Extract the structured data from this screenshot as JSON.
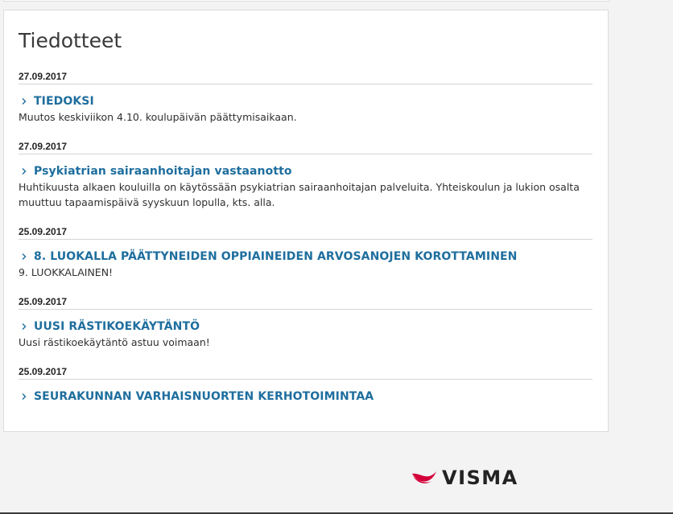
{
  "section": {
    "title": "Tiedotteet"
  },
  "news": [
    {
      "date": "27.09.2017",
      "title": "TIEDOKSI",
      "body": "Muutos keskiviikon 4.10. koulupäivän päättymisaikaan."
    },
    {
      "date": "27.09.2017",
      "title": "Psykiatrian sairaanhoitajan vastaanotto",
      "body": "Huhtikuusta alkaen kouluilla on käytössään psykiatrian sairaanhoitajan palveluita. Yhteiskoulun ja lukion osalta muuttuu tapaamispäivä syyskuun lopulla, kts. alla."
    },
    {
      "date": "25.09.2017",
      "title": "8. LUOKALLA PÄÄTTYNEIDEN OPPIAINEIDEN ARVOSANOJEN KOROTTAMINEN",
      "body": "9. LUOKKALAINEN!"
    },
    {
      "date": "25.09.2017",
      "title": "UUSI RÄSTIKOEKÄYTÄNTÖ",
      "body": "Uusi rästikoekäytäntö astuu voimaan!"
    },
    {
      "date": "25.09.2017",
      "title": "SEURAKUNNAN VARHAISNUORTEN KERHOTOIMINTAA",
      "body": ""
    }
  ],
  "footer": {
    "logo_text": "VISMA",
    "logo_icon": "visma-logo-icon",
    "logo_color": "#d4003a"
  },
  "colors": {
    "link": "#1e6e9e",
    "background": "#f3f3f3",
    "card": "#ffffff"
  }
}
